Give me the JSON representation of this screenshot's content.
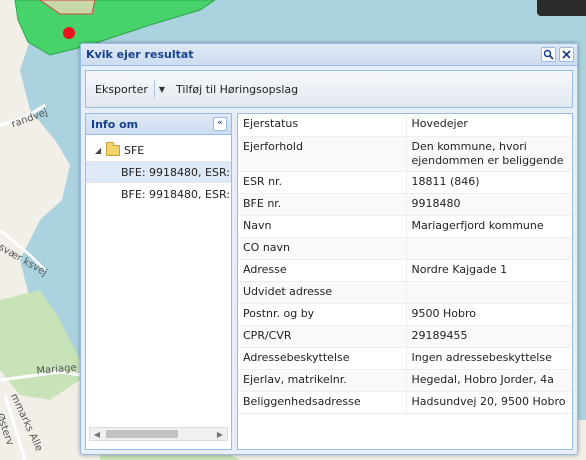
{
  "map": {
    "street_labels": [
      "randvej",
      "svær ksvej",
      "Mariage",
      "mmarks Alle",
      "Østerv"
    ]
  },
  "dialog": {
    "title": "Kvik ejer resultat",
    "tools": {
      "search_icon": "magnifier-icon",
      "close_icon": "close-icon"
    }
  },
  "toolbar": {
    "export_label": "Eksporter",
    "hearing_label": "Tilføj til Høringsopslag"
  },
  "info_panel": {
    "title": "Info om",
    "tree": {
      "root_label": "SFE",
      "children": [
        "BFE: 9918480, ESR:",
        "BFE: 9918480, ESR:"
      ]
    }
  },
  "properties": [
    {
      "key": "Ejerstatus",
      "value": "Hovedejer"
    },
    {
      "key": "Ejerforhold",
      "value": "Den kommune, hvori ejendommen er beliggende"
    },
    {
      "key": "ESR nr.",
      "value": "18811 (846)"
    },
    {
      "key": "BFE nr.",
      "value": "9918480"
    },
    {
      "key": "Navn",
      "value": "Mariagerfjord kommune"
    },
    {
      "key": "CO navn",
      "value": ""
    },
    {
      "key": "Adresse",
      "value": "Nordre Kajgade 1"
    },
    {
      "key": "Udvidet adresse",
      "value": ""
    },
    {
      "key": "Postnr. og by",
      "value": "9500 Hobro"
    },
    {
      "key": "CPR/CVR",
      "value": "29189455"
    },
    {
      "key": "Adressebeskyttelse",
      "value": "Ingen adressebeskyttelse"
    },
    {
      "key": "Ejerlav, matrikelnr.",
      "value": "Hegedal, Hobro Jorder, 4a"
    },
    {
      "key": "Beliggenhedsadresse",
      "value": "Hadsundvej 20, 9500 Hobro"
    }
  ],
  "colors": {
    "water": "#aad3df",
    "land": "#f2efe9",
    "park": "#add19e",
    "selection": "#47d36a",
    "marker": "#e8141b",
    "header_text": "#15428b"
  }
}
